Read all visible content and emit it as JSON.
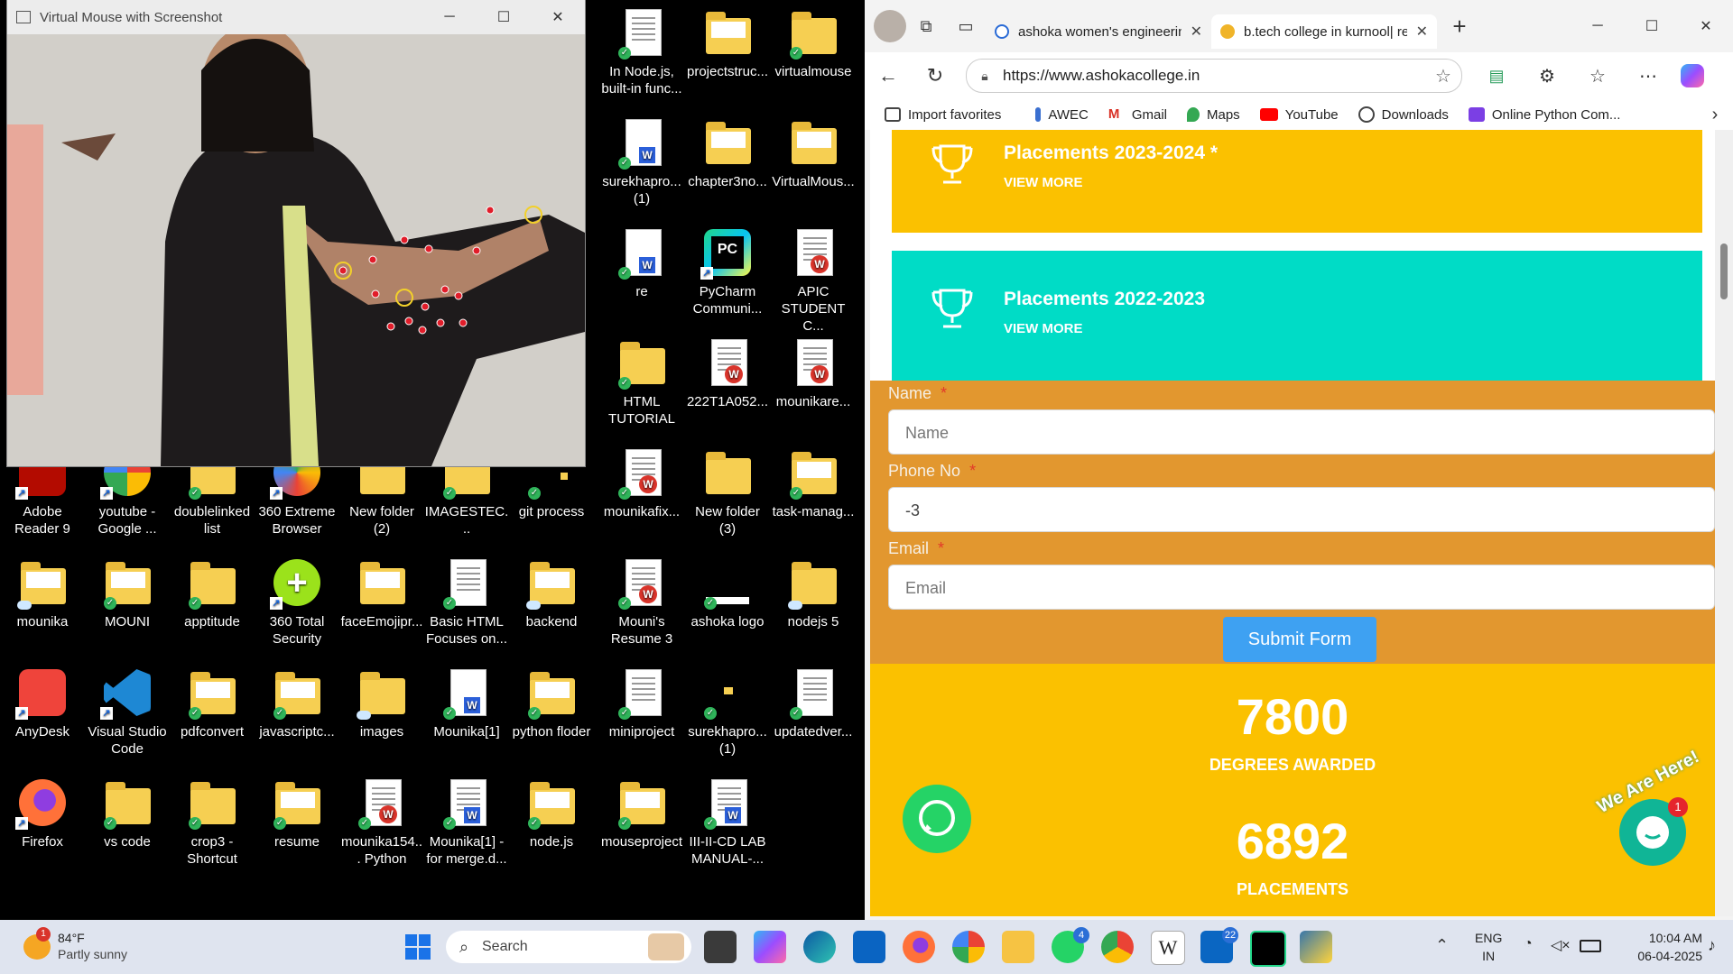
{
  "camera_window": {
    "title": "Virtual Mouse with Screenshot"
  },
  "desktop": {
    "col1": [
      {
        "label": "In Node.js, built-in func..."
      },
      {
        "label": "surekhapro... (1)"
      },
      {
        "label": "re"
      },
      {
        "label": "HTML TUTORIAL"
      },
      {
        "label": "mounikafix..."
      },
      {
        "label": "Mouni's Resume 3"
      },
      {
        "label": "miniproject"
      },
      {
        "label": "mouseproject"
      }
    ],
    "col2": [
      {
        "label": "projectstruc..."
      },
      {
        "label": "chapter3no..."
      },
      {
        "label": "PyCharm Communi..."
      },
      {
        "label": "222T1A052..."
      },
      {
        "label": "New folder (3)"
      },
      {
        "label": "ashoka logo"
      },
      {
        "label": "surekhapro... (1)"
      },
      {
        "label": "III-II-CD LAB MANUAL-..."
      }
    ],
    "col3": [
      {
        "label": "virtualmouse"
      },
      {
        "label": "VirtualMous..."
      },
      {
        "label": "APIC STUDENT C..."
      },
      {
        "label": "mounikare..."
      },
      {
        "label": "task-manag..."
      },
      {
        "label": "nodejs 5"
      },
      {
        "label": "updatedver..."
      }
    ],
    "row5": [
      {
        "label": "Adobe Reader 9"
      },
      {
        "label": "youtube - Google ..."
      },
      {
        "label": "doublelinked list"
      },
      {
        "label": "360 Extreme Browser"
      },
      {
        "label": "New folder (2)"
      },
      {
        "label": "IMAGESTEC..."
      },
      {
        "label": "git process"
      }
    ],
    "row6": [
      {
        "label": "mounika"
      },
      {
        "label": "MOUNI"
      },
      {
        "label": "apptitude"
      },
      {
        "label": "360 Total Security"
      },
      {
        "label": "faceEmojipr..."
      },
      {
        "label": "Basic HTML Focuses on..."
      },
      {
        "label": "backend"
      }
    ],
    "row7": [
      {
        "label": "AnyDesk"
      },
      {
        "label": "Visual Studio Code"
      },
      {
        "label": "pdfconvert"
      },
      {
        "label": "javascriptc..."
      },
      {
        "label": "images"
      },
      {
        "label": "Mounika[1]"
      },
      {
        "label": "python floder"
      }
    ],
    "row8": [
      {
        "label": "Firefox"
      },
      {
        "label": "vs code"
      },
      {
        "label": "crop3 - Shortcut"
      },
      {
        "label": "resume"
      },
      {
        "label": "mounika154... Python"
      },
      {
        "label": "Mounika[1] - for merge.d..."
      },
      {
        "label": "node.js"
      }
    ]
  },
  "browser": {
    "tabs": [
      {
        "label": "ashoka women's engineering"
      },
      {
        "label": "b.tech college in kurnool| re"
      }
    ],
    "url": "https://www.ashokacollege.in",
    "favorites": [
      {
        "label": "Import favorites"
      },
      {
        "label": "AWEC"
      },
      {
        "label": "Gmail"
      },
      {
        "label": "Maps"
      },
      {
        "label": "YouTube"
      },
      {
        "label": "Downloads"
      },
      {
        "label": "Online Python Com..."
      }
    ],
    "page": {
      "placements": [
        {
          "title": "Placements 2023-2024 *",
          "link": "VIEW MORE"
        },
        {
          "title": "Placements 2022-2023",
          "link": "VIEW MORE"
        }
      ],
      "form": {
        "name_label": "Name",
        "name_placeholder": "Name",
        "phone_label": "Phone No",
        "phone_value": "-3",
        "email_label": "Email",
        "email_placeholder": "Email",
        "required_mark": "*",
        "submit_label": "Submit Form"
      },
      "stats": [
        {
          "number": "7800",
          "label": "DEGREES AWARDED"
        },
        {
          "number": "6892",
          "label": "PLACEMENTS"
        }
      ],
      "chat_badge": "We Are Here!",
      "chat_count": "1"
    }
  },
  "taskbar": {
    "weather_temp": "84°F",
    "weather_desc": "Partly sunny",
    "weather_badge": "1",
    "search_label": "Search",
    "whatsapp_badge": "4",
    "linkedin_badge": "22",
    "lang_top": "ENG",
    "lang_bottom": "IN",
    "time": "10:04 AM",
    "date": "06-04-2025"
  },
  "colors": {
    "yellow": "#fbc100",
    "teal": "#00dcc6",
    "orange": "#e2972f",
    "submit": "#3ea1f2"
  }
}
